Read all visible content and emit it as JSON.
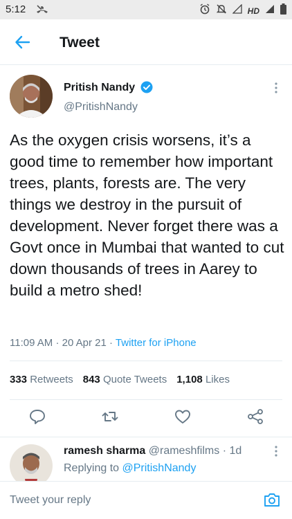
{
  "status_bar": {
    "time": "5:12",
    "network": "HD"
  },
  "header": {
    "title": "Tweet"
  },
  "tweet": {
    "author_name": "Pritish Nandy",
    "author_handle": "@PritishNandy",
    "text": "As the oxygen crisis worsens, it’s a good time to remember how important trees, plants, forests are. The very things we destroy in the pursuit of development. Never forget there was a Govt once in Mumbai that wanted to cut down thousands of trees in Aarey to build a metro shed!",
    "time": "11:09 AM",
    "date": "20 Apr 21",
    "client": "Twitter for iPhone",
    "separator": "·",
    "retweets": "333",
    "retweets_label": "Retweets",
    "quotes": "843",
    "quotes_label": "Quote Tweets",
    "likes": "1,108",
    "likes_label": "Likes"
  },
  "reply": {
    "name": "ramesh sharma",
    "handle": "@rameshfilms",
    "age": "· 1d",
    "replying_to_label": "Replying to",
    "replying_to_handle": "@PritishNandy"
  },
  "compose": {
    "placeholder": "Tweet your reply"
  },
  "colors": {
    "accent": "#1da1f2",
    "muted": "#657786",
    "text": "#14171a",
    "divider": "#e6ecf0"
  },
  "icons": [
    "missed-call-icon",
    "alarm-icon",
    "mute-icon",
    "signal-icon",
    "battery-icon",
    "back-arrow-icon",
    "verified-badge-icon",
    "more-icon",
    "reply-icon",
    "retweet-icon",
    "like-icon",
    "share-icon",
    "camera-icon"
  ]
}
